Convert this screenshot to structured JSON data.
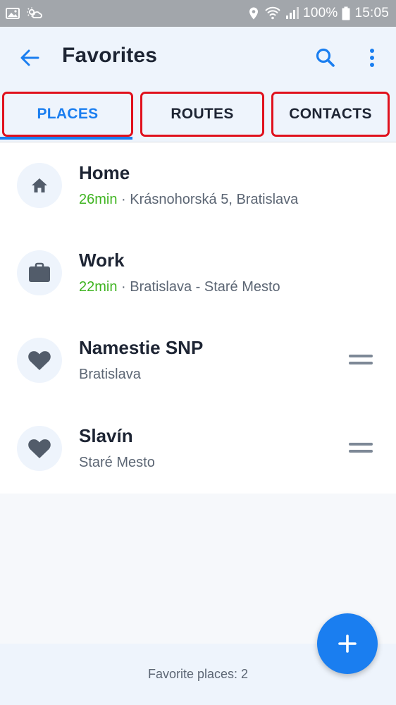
{
  "status_bar": {
    "battery": "100%",
    "time": "15:05",
    "icons": [
      "gallery-icon",
      "weather-icon",
      "location-icon",
      "wifi-icon",
      "signal-icon",
      "battery-icon"
    ]
  },
  "header": {
    "title": "Favorites",
    "icons": [
      "back-arrow-icon",
      "search-icon",
      "more-vert-icon"
    ]
  },
  "tabs": [
    {
      "label": "PLACES",
      "active": true
    },
    {
      "label": "ROUTES",
      "active": false
    },
    {
      "label": "CONTACTS",
      "active": false
    }
  ],
  "places": [
    {
      "icon": "home-icon",
      "title": "Home",
      "eta": "26min",
      "separator": " · ",
      "subtitle": "Krásnohorská 5, Bratislava"
    },
    {
      "icon": "briefcase-icon",
      "title": "Work",
      "eta": "22min",
      "separator": " · ",
      "subtitle": "Bratislava - Staré Mesto"
    },
    {
      "icon": "heart-icon",
      "title": "Namestie SNP",
      "subtitle": "Bratislava"
    },
    {
      "icon": "heart-icon",
      "title": "Slavín",
      "subtitle": "Staré Mesto"
    }
  ],
  "footer": {
    "text": "Favorite places: 2"
  },
  "fab": {
    "icon": "plus-icon"
  },
  "colors": {
    "accent": "#1a7ef0",
    "eta_green": "#3fb421",
    "tab_highlight_border": "#e0111d",
    "status_bar": "#a2a6ab",
    "header_bg": "#eef4fc"
  }
}
